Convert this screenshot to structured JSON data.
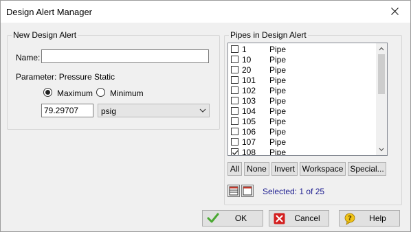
{
  "window": {
    "title": "Design Alert Manager"
  },
  "new_alert": {
    "group_label": "New Design Alert",
    "name_label": "Name:",
    "name_value": "",
    "parameter_label": "Parameter: Pressure Static",
    "maximum_label": "Maximum",
    "minimum_label": "Minimum",
    "selected_limit": "Maximum",
    "value": "79.29707",
    "unit": "psig"
  },
  "pipes": {
    "group_label": "Pipes in Design Alert",
    "items": [
      {
        "id": "1",
        "type": "Pipe",
        "checked": false
      },
      {
        "id": "10",
        "type": "Pipe",
        "checked": false
      },
      {
        "id": "20",
        "type": "Pipe",
        "checked": false
      },
      {
        "id": "101",
        "type": "Pipe",
        "checked": false
      },
      {
        "id": "102",
        "type": "Pipe",
        "checked": false
      },
      {
        "id": "103",
        "type": "Pipe",
        "checked": false
      },
      {
        "id": "104",
        "type": "Pipe",
        "checked": false
      },
      {
        "id": "105",
        "type": "Pipe",
        "checked": false
      },
      {
        "id": "106",
        "type": "Pipe",
        "checked": false
      },
      {
        "id": "107",
        "type": "Pipe",
        "checked": false
      },
      {
        "id": "108",
        "type": "Pipe",
        "checked": true
      }
    ],
    "buttons": {
      "all": "All",
      "none": "None",
      "invert": "Invert",
      "workspace": "Workspace",
      "special": "Special..."
    },
    "selected_text": "Selected: 1 of 25"
  },
  "footer": {
    "ok": "OK",
    "cancel": "Cancel",
    "help": "Help"
  },
  "icons": {
    "close": "close-icon",
    "ok": "check-icon",
    "cancel": "cancel-icon",
    "help": "help-icon",
    "grid_view": "grid-view-icon",
    "list_view": "list-view-icon"
  },
  "colors": {
    "ok_check": "#4aa832",
    "cancel_red": "#d32020",
    "help_yellow": "#f0c419",
    "selected_text": "#1b1b8f"
  }
}
